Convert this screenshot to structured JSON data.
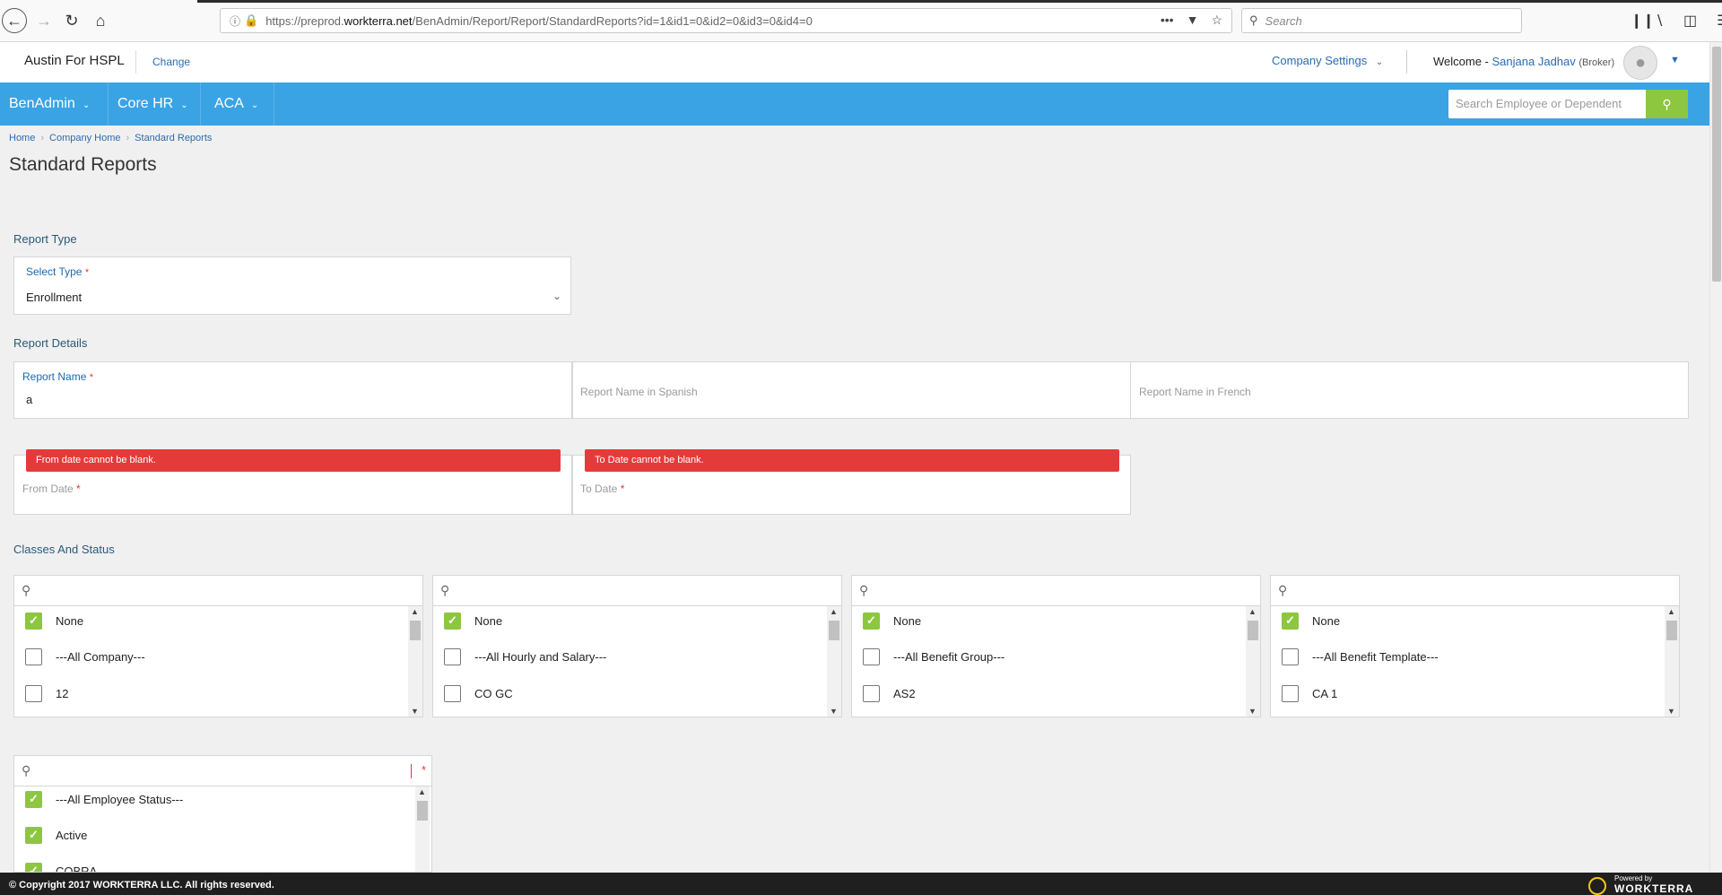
{
  "browser": {
    "url_prefix": "https://preprod.",
    "url_host": "workterra.net",
    "url_path": "/BenAdmin/Report/Report/StandardReports?id=1&id1=0&id2=0&id3=0&id4=0",
    "search_placeholder": "Search",
    "icons": [
      "back-icon",
      "forward-icon",
      "reload-icon",
      "home-icon",
      "info-icon",
      "lock-icon",
      "more-icon",
      "pocket-icon",
      "bookmark-star-icon",
      "library-icon",
      "sidebar-icon",
      "menu-icon"
    ]
  },
  "header": {
    "company": "Austin For HSPL",
    "change_label": "Change",
    "company_settings_label": "Company Settings",
    "welcome_label": "Welcome -",
    "user_name": "Sanjana Jadhav",
    "user_role": "(Broker)"
  },
  "nav": {
    "items": [
      {
        "label": "BenAdmin"
      },
      {
        "label": "Core HR"
      },
      {
        "label": "ACA"
      }
    ],
    "search_placeholder": "Search Employee or Dependent"
  },
  "breadcrumb": [
    "Home",
    "Company Home",
    "Standard Reports"
  ],
  "page_title": "Standard Reports",
  "report_type": {
    "section_label": "Report Type",
    "select_label": "Select Type",
    "required_mark": "*",
    "selected_value": "Enrollment"
  },
  "report_details": {
    "section_label": "Report Details",
    "report_name_label": "Report Name",
    "report_name_value": "a",
    "spanish_placeholder": "Report Name in Spanish",
    "french_placeholder": "Report Name in French",
    "from_date_label": "From Date",
    "to_date_label": "To Date",
    "from_date_error": "From date cannot be blank.",
    "to_date_error": "To Date cannot be blank."
  },
  "classes_and_status": {
    "section_label": "Classes And Status",
    "lists": [
      {
        "items": [
          {
            "label": "None",
            "checked": true
          },
          {
            "label": "---All Company---",
            "checked": false
          },
          {
            "label": "12",
            "checked": false
          }
        ]
      },
      {
        "items": [
          {
            "label": "None",
            "checked": true
          },
          {
            "label": "---All Hourly and Salary---",
            "checked": false
          },
          {
            "label": "CO GC",
            "checked": false
          }
        ]
      },
      {
        "items": [
          {
            "label": "None",
            "checked": true
          },
          {
            "label": "---All Benefit Group---",
            "checked": false
          },
          {
            "label": "AS2",
            "checked": false
          }
        ]
      },
      {
        "items": [
          {
            "label": "None",
            "checked": true
          },
          {
            "label": "---All Benefit Template---",
            "checked": false
          },
          {
            "label": "CA 1",
            "checked": false
          }
        ]
      }
    ],
    "status_list": {
      "required_mark": "*",
      "items": [
        {
          "label": "---All Employee Status---",
          "checked": true
        },
        {
          "label": "Active",
          "checked": true
        },
        {
          "label": "COBRA",
          "checked": true
        }
      ]
    }
  },
  "footer": {
    "copyright": "© Copyright 2017 WORKTERRA LLC. All rights reserved.",
    "powered_by": "Powered by",
    "brand": "WORKTERRA"
  },
  "colors": {
    "nav_blue": "#3aa3e3",
    "check_green": "#8dc63f",
    "error_red": "#e53a3a",
    "link_blue": "#2a6bb0"
  }
}
